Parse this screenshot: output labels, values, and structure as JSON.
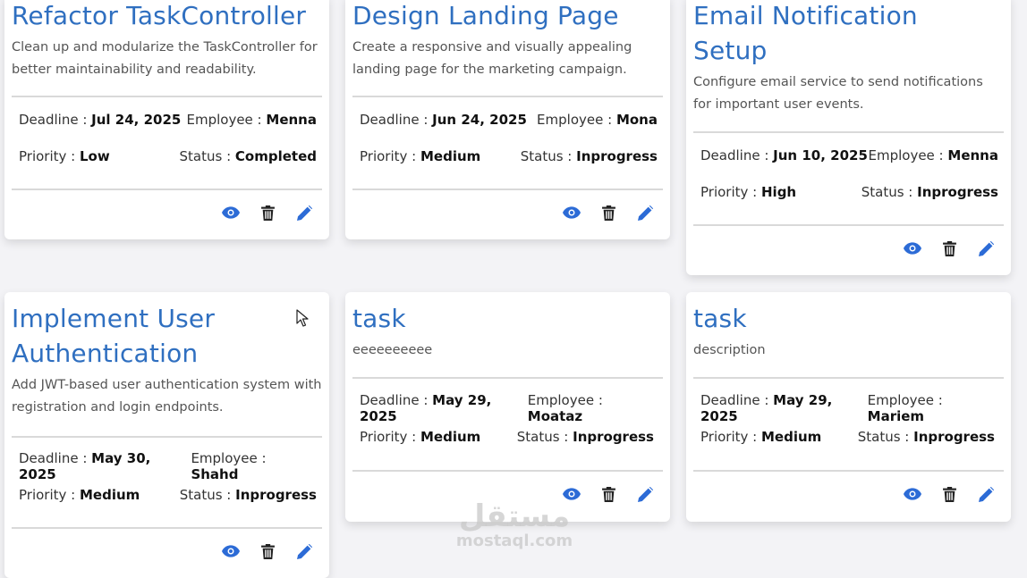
{
  "labels": {
    "deadline": "Deadline :",
    "employee": "Employee :",
    "priority": "Priority :",
    "status": "Status :"
  },
  "colors": {
    "accent": "#2f6fc0",
    "icon_blue": "#2c6bd6",
    "icon_dark": "#222222"
  },
  "icons": {
    "view": "eye-icon",
    "delete": "trash-icon",
    "edit": "pencil-icon"
  },
  "tasks": [
    {
      "title": "Refactor TaskController",
      "description": "Clean up and modularize the TaskController for better maintainability and readability.",
      "deadline": "Jul 24, 2025",
      "employee": "Menna",
      "priority": "Low",
      "status": "Completed"
    },
    {
      "title": "Design Landing Page",
      "description": "Create a responsive and visually appealing landing page for the marketing campaign.",
      "deadline": "Jun 24, 2025",
      "employee": "Mona",
      "priority": "Medium",
      "status": "Inprogress"
    },
    {
      "title": "Email Notification Setup",
      "description": "Configure email service to send notifications for important user events.",
      "deadline": "Jun 10, 2025",
      "employee": "Menna",
      "priority": "High",
      "status": "Inprogress"
    },
    {
      "title": "Implement User Authentication",
      "description": "Add JWT-based user authentication system with registration and login endpoints.",
      "deadline": "May 30, 2025",
      "employee": "Shahd",
      "priority": "Medium",
      "status": "Inprogress"
    },
    {
      "title": "task",
      "description": "eeeeeeeeee",
      "deadline": "May 29, 2025",
      "employee": "Moataz",
      "priority": "Medium",
      "status": "Inprogress"
    },
    {
      "title": "task",
      "description": "description",
      "deadline": "May 29, 2025",
      "employee": "Mariem",
      "priority": "Medium",
      "status": "Inprogress"
    }
  ],
  "watermark": {
    "arabic": "مستقل",
    "latin": "mostaql.com"
  }
}
